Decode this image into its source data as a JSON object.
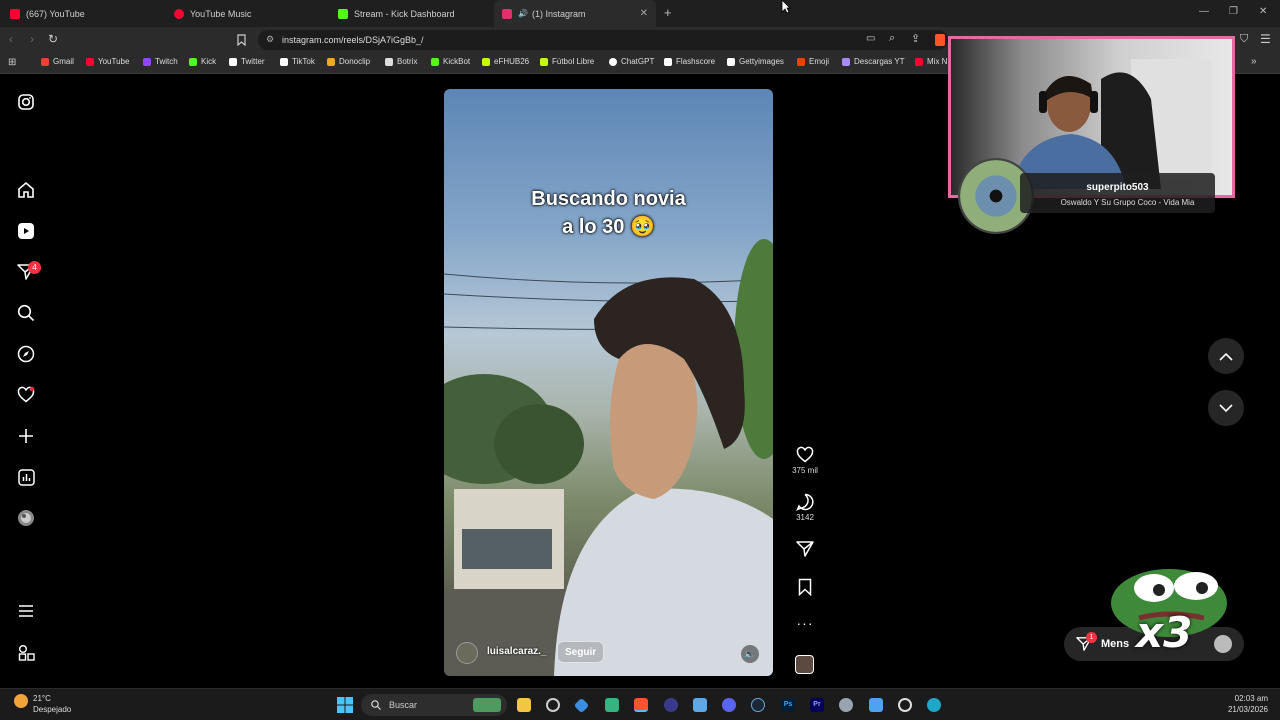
{
  "browser": {
    "tabs": [
      {
        "label": "(667) YouTube",
        "color": "#ff0033"
      },
      {
        "label": "YouTube Music",
        "color": "#ff0033"
      },
      {
        "label": "Stream - Kick Dashboard",
        "color": "#53fc18"
      },
      {
        "label": "(1) Instagram",
        "color": "#e1306c"
      }
    ],
    "url": "instagram.com/reels/DSjA7iGgBb_/",
    "bookmarks": [
      {
        "label": "Gmail",
        "color": "#ea4335"
      },
      {
        "label": "YouTube",
        "color": "#ff0033"
      },
      {
        "label": "Twitch",
        "color": "#9146ff"
      },
      {
        "label": "Kick",
        "color": "#53fc18"
      },
      {
        "label": "Twitter",
        "color": "#ffffff"
      },
      {
        "label": "TikTok",
        "color": "#ffffff"
      },
      {
        "label": "Donoclip",
        "color": "#f5a623"
      },
      {
        "label": "Botrix",
        "color": "#dddddd"
      },
      {
        "label": "KickBot",
        "color": "#53fc18"
      },
      {
        "label": "eFHUB26",
        "color": "#c6ff00"
      },
      {
        "label": "Fútbol Libre",
        "color": "#c6ff00"
      },
      {
        "label": "ChatGPT",
        "color": "#ffffff"
      },
      {
        "label": "Flashscore",
        "color": "#ffffff"
      },
      {
        "label": "Gettyimages",
        "color": "#ffffff"
      },
      {
        "label": "Emoji",
        "color": "#ff3d00"
      },
      {
        "label": "Descargas YT",
        "color": "#a78bfa"
      },
      {
        "label": "Mix N",
        "color": "#ff0033"
      }
    ]
  },
  "sidebar": {
    "notification_count": "4"
  },
  "reel": {
    "caption_line1": "Buscando novia",
    "caption_line2": "a lo 30 🥹",
    "likes": "375 mil",
    "comments": "3142",
    "username": "luisalcaraz._",
    "follow_label": "Seguir"
  },
  "overlay": {
    "streamer": "superpito503",
    "song": "Oswaldo Y Su Grupo Coco - Vida Mia",
    "messages_label": "Mens",
    "messages_badge": "1",
    "emote_text": "x3"
  },
  "taskbar": {
    "weather_temp": "21°C",
    "weather_desc": "Despejado",
    "search_placeholder": "Buscar",
    "time": "02:03 am",
    "date": "21/03/2026"
  }
}
